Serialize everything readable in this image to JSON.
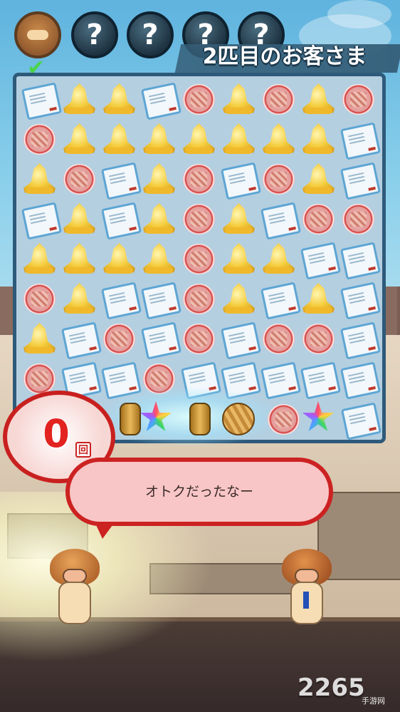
{
  "header": {
    "customers": [
      {
        "label": "",
        "icon": "mushroom-customer-icon",
        "served": true
      },
      {
        "label": "?",
        "icon": "unknown-customer-icon"
      },
      {
        "label": "?",
        "icon": "unknown-customer-icon"
      },
      {
        "label": "?",
        "icon": "unknown-customer-icon"
      },
      {
        "label": "?",
        "icon": "unknown-customer-icon"
      }
    ],
    "title": "2匹目のお客さま"
  },
  "board": {
    "rows": [
      [
        "ticket",
        "bell",
        "bell",
        "ticket",
        "meat",
        "bell",
        "meat",
        "bell",
        "meat"
      ],
      [
        "meat",
        "bell",
        "bell",
        "bell",
        "bell",
        "bell",
        "bell",
        "bell",
        "ticket"
      ],
      [
        "bell",
        "meat",
        "ticket",
        "bell",
        "meat",
        "ticket",
        "meat",
        "bell",
        "ticket"
      ],
      [
        "ticket",
        "bell",
        "ticket",
        "bell",
        "meat",
        "bell",
        "ticket",
        "meat",
        "meat"
      ],
      [
        "bell",
        "bell",
        "bell",
        "bell",
        "meat",
        "bell",
        "bell",
        "ticket",
        "ticket"
      ],
      [
        "meat",
        "bell",
        "ticket",
        "ticket",
        "meat",
        "bell",
        "ticket",
        "bell",
        "ticket"
      ],
      [
        "bell",
        "ticket",
        "meat",
        "ticket",
        "meat",
        "ticket",
        "meat",
        "meat",
        "ticket"
      ],
      [
        "meat",
        "ticket",
        "ticket",
        "meat",
        "ticket",
        "ticket",
        "ticket",
        "ticket",
        "ticket"
      ]
    ],
    "special_items": [
      "barrel-icon",
      "rainbow-star-icon",
      "barrel-icon",
      "yarn-ball-icon",
      "meat-icon",
      "rainbow-star-icon",
      "ticket-icon"
    ]
  },
  "counter": {
    "value": "0",
    "unit": "回"
  },
  "speech": {
    "text": "オトクだったなー"
  },
  "watermark": {
    "brand": "2265",
    "sub": "手游网"
  },
  "colors": {
    "board_border": "#2e5a7a",
    "counter_red": "#e2231f",
    "bubble_fill": "#f8c6c6",
    "bubble_border": "#cc2222"
  }
}
